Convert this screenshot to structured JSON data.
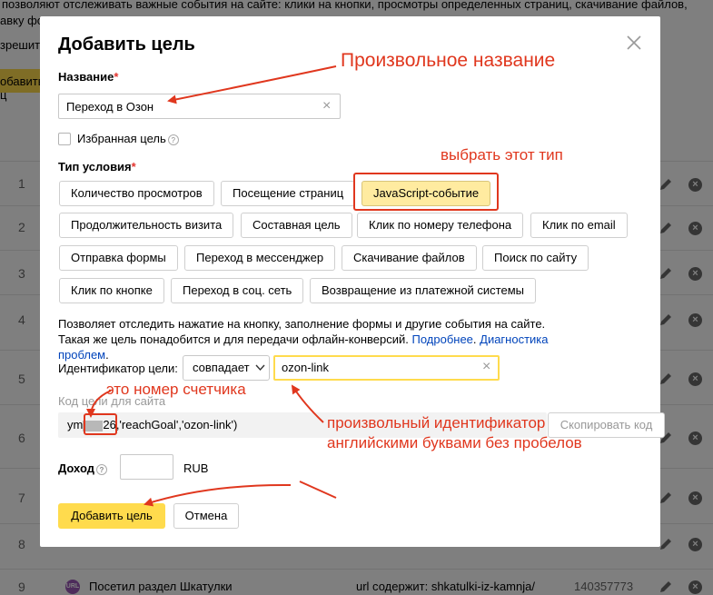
{
  "background": {
    "line1": "позволяют отслеживать важные события на сайте: клики на кнопки, просмотры определенных страниц, скачивание файлов,",
    "line2": "авку фо",
    "line3": "зрешит",
    "button_label": "обавить ц",
    "row_numbers": [
      "1",
      "2",
      "3",
      "4",
      "5",
      "6",
      "7",
      "8",
      "9"
    ],
    "row9": {
      "badge": "URL",
      "name": "Посетил раздел Шкатулки",
      "condition": "url содержит: shkatulki-iz-kamnja/",
      "id": "140357773"
    }
  },
  "modal": {
    "title": "Добавить цель",
    "name_label": "Название",
    "required_mark": "*",
    "name_value": "Переход в Озон",
    "favorite_label": "Избранная цель",
    "condition_type_label": "Тип условия",
    "condition_types": [
      "Количество просмотров",
      "Посещение страниц",
      "JavaScript-событие",
      "Продолжительность визита",
      "Составная цель",
      "Клик по номеру телефона",
      "Клик по email",
      "Отправка формы",
      "Переход в мессенджер",
      "Скачивание файлов",
      "Поиск по сайту",
      "Клик по кнопке",
      "Переход в соц. сеть",
      "Возвращение из платежной системы"
    ],
    "selected_type": "JavaScript-событие",
    "description": "Позволяет отследить нажатие на кнопку, заполнение формы и другие события на сайте. Такая же цель понадобится и для передачи офлайн-конверсий.",
    "link_more": "Подробнее",
    "link_diag": "Диагностика проблем",
    "identifier_label": "Идентификатор цели:",
    "match_select": "совпадает",
    "identifier_value": "ozon-link",
    "code_label": "Код цели для сайта",
    "code_prefix": "ym",
    "code_counter_tail": "26",
    "code_suffix": ",'reachGoal','ozon-link')",
    "copy_button": "Скопировать код",
    "income_label": "Доход",
    "income_currency": "RUB",
    "add_button": "Добавить цель",
    "cancel_button": "Отмена"
  },
  "annotations": {
    "arbitrary_name": "Произвольное название",
    "choose_type": "выбрать этот тип",
    "counter_number": "это номер счетчика",
    "arbitrary_id_line1": "произвольный идентификатор",
    "arbitrary_id_line2": "английскими буквами без пробелов",
    "color": "#e0371e"
  }
}
